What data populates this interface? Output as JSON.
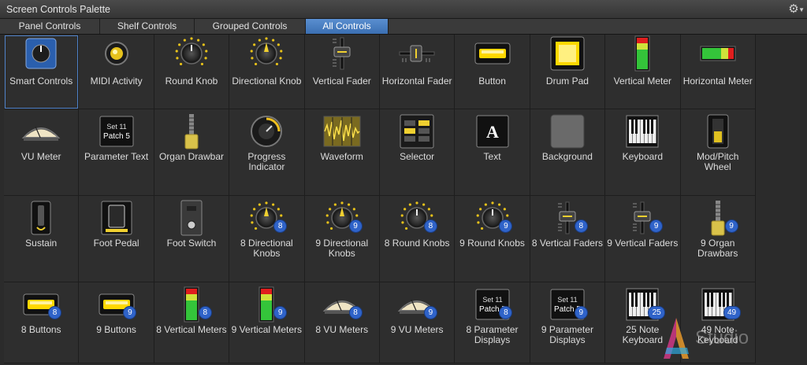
{
  "window": {
    "title": "Screen Controls Palette"
  },
  "icons": {
    "settings": "gear-icon",
    "menu": "chevron-down-icon"
  },
  "tabs": [
    {
      "label": "Panel Controls",
      "active": false
    },
    {
      "label": "Shelf Controls",
      "active": false
    },
    {
      "label": "Grouped Controls",
      "active": false
    },
    {
      "label": "All Controls",
      "active": true
    }
  ],
  "colors": {
    "accent": "#3b6fb2",
    "badge": "#2f63c9",
    "led_yellow": "#ffd800",
    "meter_green": "#34c43a",
    "meter_red": "#e01e1e"
  },
  "controls": [
    {
      "label": "Smart Controls",
      "icon": "smart-controls-icon"
    },
    {
      "label": "MIDI Activity",
      "icon": "midi-activity-icon"
    },
    {
      "label": "Round Knob",
      "icon": "round-knob-icon"
    },
    {
      "label": "Directional Knob",
      "icon": "directional-knob-icon"
    },
    {
      "label": "Vertical Fader",
      "icon": "vertical-fader-icon"
    },
    {
      "label": "Horizontal Fader",
      "icon": "horizontal-fader-icon"
    },
    {
      "label": "Button",
      "icon": "button-icon"
    },
    {
      "label": "Drum Pad",
      "icon": "drum-pad-icon"
    },
    {
      "label": "Vertical Meter",
      "icon": "vertical-meter-icon"
    },
    {
      "label": "Horizontal Meter",
      "icon": "horizontal-meter-icon"
    },
    {
      "label": "VU Meter",
      "icon": "vu-meter-icon"
    },
    {
      "label": "Parameter Text",
      "icon": "parameter-text-icon",
      "display_line1": "Set 11",
      "display_line2": "Patch 5"
    },
    {
      "label": "Organ Drawbar",
      "icon": "organ-drawbar-icon"
    },
    {
      "label": "Progress Indicator",
      "icon": "progress-indicator-icon"
    },
    {
      "label": "Waveform",
      "icon": "waveform-icon"
    },
    {
      "label": "Selector",
      "icon": "selector-icon"
    },
    {
      "label": "Text",
      "icon": "text-icon",
      "glyph": "A"
    },
    {
      "label": "Background",
      "icon": "background-icon"
    },
    {
      "label": "Keyboard",
      "icon": "keyboard-icon"
    },
    {
      "label": "Mod/Pitch Wheel",
      "icon": "mod-pitch-wheel-icon"
    },
    {
      "label": "Sustain",
      "icon": "sustain-icon"
    },
    {
      "label": "Foot Pedal",
      "icon": "foot-pedal-icon"
    },
    {
      "label": "Foot Switch",
      "icon": "foot-switch-icon"
    },
    {
      "label": "8 Directional Knobs",
      "icon": "directional-knob-icon",
      "badge": "8"
    },
    {
      "label": "9 Directional Knobs",
      "icon": "directional-knob-icon",
      "badge": "9"
    },
    {
      "label": "8 Round Knobs",
      "icon": "round-knob-icon",
      "badge": "8"
    },
    {
      "label": "9 Round Knobs",
      "icon": "round-knob-icon",
      "badge": "9"
    },
    {
      "label": "8 Vertical Faders",
      "icon": "vertical-fader-icon",
      "badge": "8"
    },
    {
      "label": "9 Vertical Faders",
      "icon": "vertical-fader-icon",
      "badge": "9"
    },
    {
      "label": "9 Organ Drawbars",
      "icon": "organ-drawbar-icon",
      "badge": "9"
    },
    {
      "label": "8 Buttons",
      "icon": "button-icon",
      "badge": "8"
    },
    {
      "label": "9 Buttons",
      "icon": "button-icon",
      "badge": "9"
    },
    {
      "label": "8 Vertical Meters",
      "icon": "vertical-meter-icon",
      "badge": "8"
    },
    {
      "label": "9 Vertical Meters",
      "icon": "vertical-meter-icon",
      "badge": "9"
    },
    {
      "label": "8 VU Meters",
      "icon": "vu-meter-icon",
      "badge": "8"
    },
    {
      "label": "9 VU Meters",
      "icon": "vu-meter-icon",
      "badge": "9"
    },
    {
      "label": "8 Parameter Displays",
      "icon": "parameter-text-icon",
      "badge": "8",
      "display_line1": "Set 11",
      "display_line2": "Patch 5"
    },
    {
      "label": "9 Parameter Displays",
      "icon": "parameter-text-icon",
      "badge": "9",
      "display_line1": "Set 11",
      "display_line2": "Patch 5"
    },
    {
      "label": "25 Note Keyboard",
      "icon": "keyboard-icon",
      "badge": "25"
    },
    {
      "label": "49 Note Keyboard",
      "icon": "keyboard-icon",
      "badge": "49"
    }
  ],
  "watermark": {
    "text": "Studio",
    "icon": "logo-icon"
  }
}
